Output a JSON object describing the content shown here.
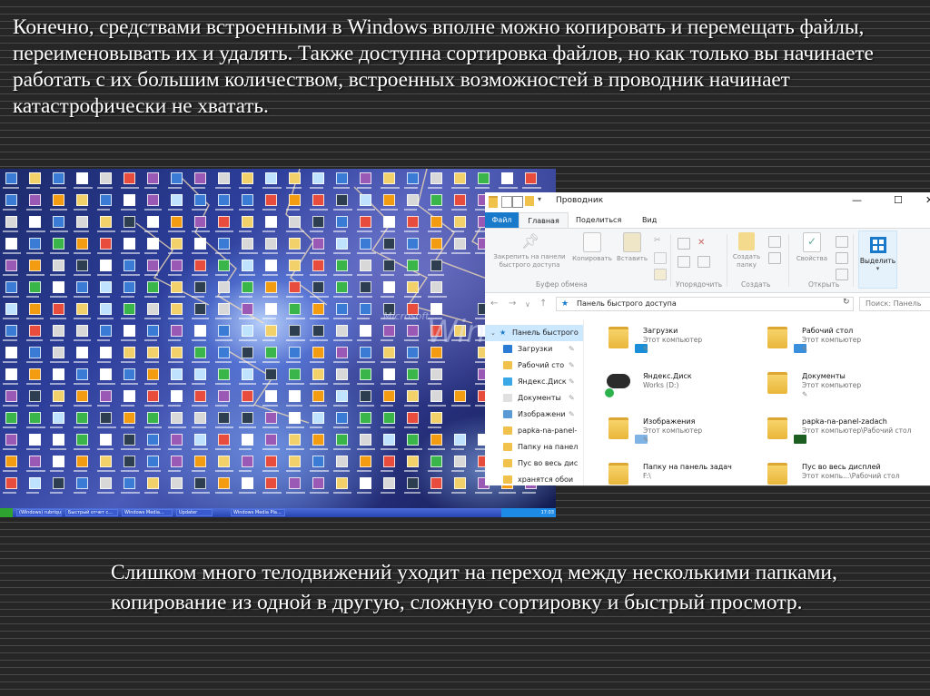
{
  "slide": {
    "top_text": "Конечно, средствами встроенными в Windows вполне можно копировать и перемещать файлы, переименовывать их и удалять. Также доступна сортировка файлов, но как только вы начинаете работать с их большим количеством, встроенных возможностей в проводник начинает катастрофически не хватать.",
    "bottom_text": "Слишком много телодвижений уходит на переход между несколькими папками, копирование из одной в другую, сложную сортировку и быстрый просмотр."
  },
  "desktop": {
    "brand_small": "Microsoft",
    "brand_large": "Windo",
    "taskbar_items": [
      "(Windows) rubrique",
      "Быстрый отчет с...",
      "Windows Media...",
      "Updater",
      "Windows Media Pla..."
    ],
    "tray_time": "17:03"
  },
  "explorer": {
    "title": "Проводник",
    "window_controls": {
      "minimize": "—",
      "maximize": "☐",
      "close": "✕"
    },
    "tabs": {
      "file": "Файл",
      "home": "Главная",
      "share": "Поделиться",
      "view": "Вид"
    },
    "ribbon": {
      "pin_label": "Закрепить на панели быстрого доступа",
      "copy_label": "Копировать",
      "paste_label": "Вставить",
      "new_folder_label": "Создать папку",
      "properties_label": "Свойства",
      "select_label": "Выделить",
      "group_clipboard": "Буфер обмена",
      "group_organize": "Упорядочить",
      "group_new": "Создать",
      "group_open": "Открыть"
    },
    "address": {
      "path": "Панель быстрого доступа",
      "search_placeholder": "Поиск: Панель"
    },
    "nav": {
      "root": "Панель быстрого",
      "items": [
        "Загрузки",
        "Рабочий сто",
        "Яндекс.Диск",
        "Документы",
        "Изображени",
        "papka-na-panel-",
        "Папку на панел",
        "Пус во весь дис",
        "хранятся обои"
      ]
    },
    "items": [
      {
        "name": "Загрузки",
        "sub": "Этот компьютер",
        "pin": "✎"
      },
      {
        "name": "Рабочий стол",
        "sub": "Этот компьютер",
        "pin": "✎"
      },
      {
        "name": "Яндекс.Диск",
        "sub": "Works (D:)",
        "pin": ""
      },
      {
        "name": "Документы",
        "sub": "Этот компьютер",
        "pin": "✎"
      },
      {
        "name": "Изображения",
        "sub": "Этот компьютер",
        "pin": "✎"
      },
      {
        "name": "papka-na-panel-zadach",
        "sub": "Этот компьютер\\Рабочий стол",
        "pin": ""
      },
      {
        "name": "Папку на панель задач",
        "sub": "F:\\",
        "pin": ""
      },
      {
        "name": "Пус во весь дисплей",
        "sub": "Этот компь...\\Рабочий стол",
        "pin": ""
      }
    ],
    "colors": {
      "accent": "#1979ca",
      "folder": "#f0c24b",
      "selected": "#cce8ff"
    }
  }
}
